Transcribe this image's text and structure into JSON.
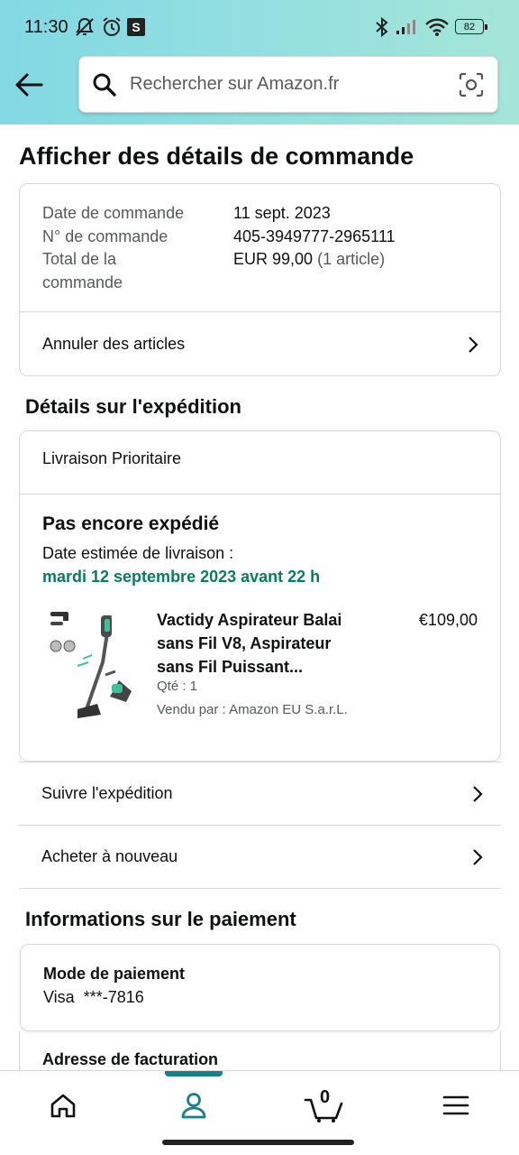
{
  "status_bar": {
    "time": "11:30",
    "s_badge": "S",
    "battery": "82"
  },
  "search": {
    "placeholder": "Rechercher sur Amazon.fr"
  },
  "page_title": "Afficher des détails de commande",
  "order_summary": {
    "rows": [
      {
        "label": "Date de commande",
        "value": "11 sept. 2023"
      },
      {
        "label": "N° de commande",
        "value": "405-3949777-2965111"
      },
      {
        "label": "Total de la commande",
        "value": "EUR 99,00",
        "extra": "(1 article)"
      }
    ],
    "cancel_label": "Annuler des articles"
  },
  "shipping": {
    "section_title": "Détails sur l'expédition",
    "method": "Livraison Prioritaire",
    "status": "Pas encore expédié",
    "eta_label": "Date estimée de livraison :",
    "eta_date": "mardi 12 septembre 2023 avant 22 h",
    "eta_color": "#067d62",
    "item": {
      "title": "Vactidy Aspirateur Balai sans Fil V8, Aspirateur sans Fil Puissant...",
      "price": "€109,00",
      "qty": "Qté : 1",
      "seller": "Vendu par : Amazon EU S.a.r.L."
    },
    "track_label": "Suivre l'expédition",
    "buy_again_label": "Acheter à nouveau"
  },
  "payment": {
    "section_title": "Informations sur le paiement",
    "method_title": "Mode de paiement",
    "method_value": "Visa  ***-7816",
    "billing_title": "Adresse de facturation"
  },
  "bottom_nav": {
    "active_tab": "account",
    "cart_count": "0",
    "accent_color": "#1b7e8c"
  }
}
